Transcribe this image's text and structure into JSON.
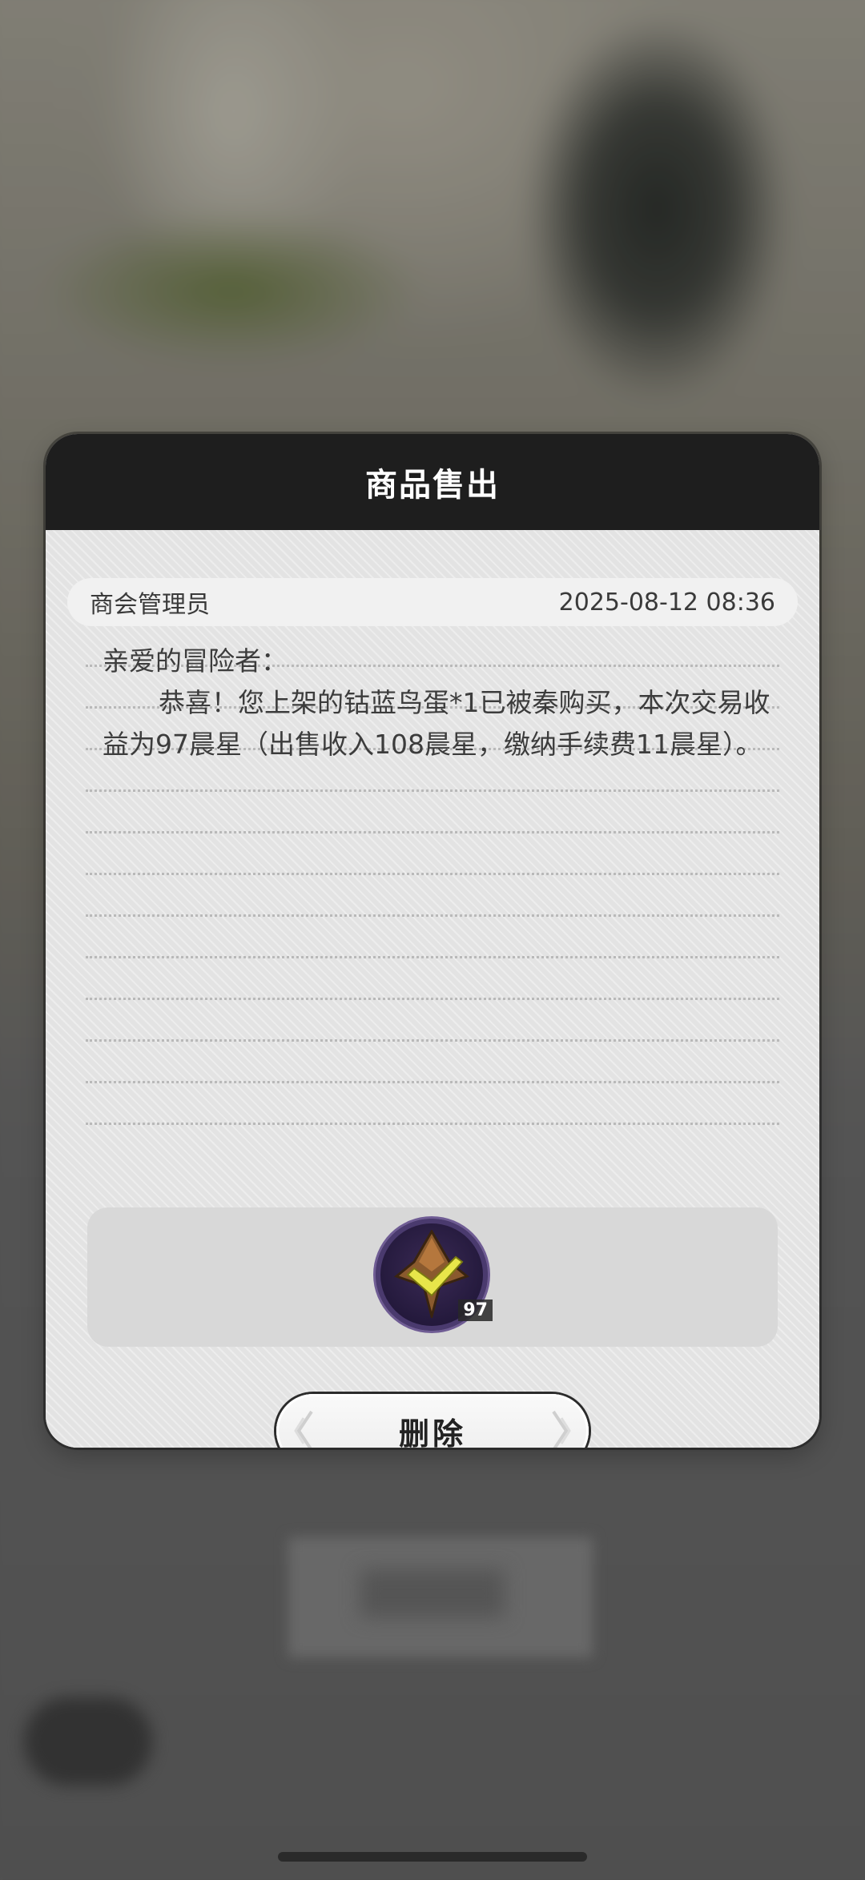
{
  "dialog": {
    "title": "商品售出",
    "sender": "商会管理员",
    "timestamp": "2025-08-12 08:36",
    "greeting": "亲爱的冒险者：",
    "content": "恭喜！您上架的钴蓝鸟蛋*1已被秦购买，本次交易收益为97晨星（出售收入108晨星，缴纳手续费11晨星）。",
    "reward": {
      "icon": "morning-star-currency-icon",
      "count": "97"
    },
    "delete_label": "删除"
  },
  "colors": {
    "header_bg": "#1e1e1e",
    "body_bg": "#e3e3e3",
    "reward_ring": "#4a3a6e",
    "reward_check": "#e8e64a"
  }
}
